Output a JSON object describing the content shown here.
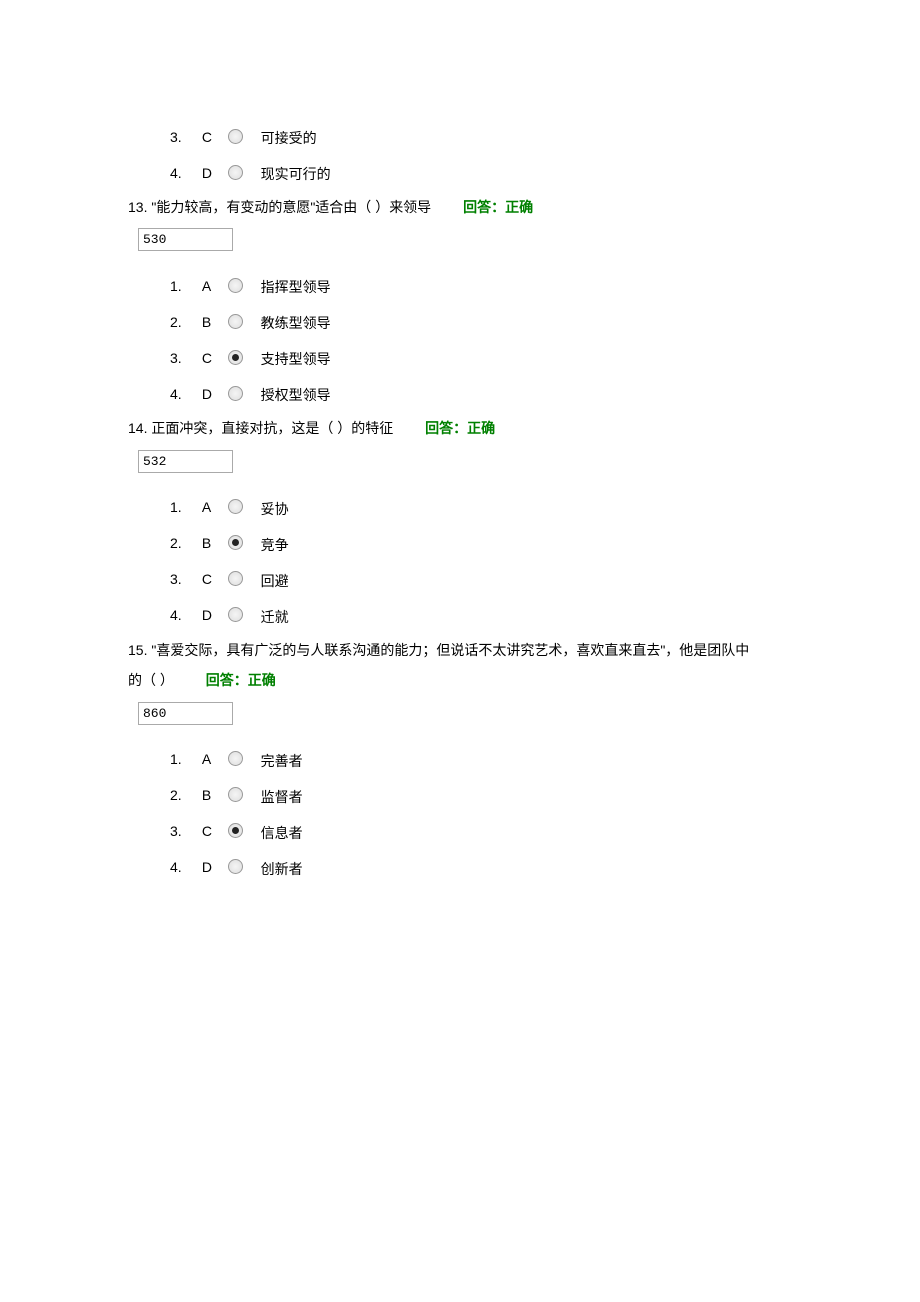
{
  "partial_q12": {
    "options": [
      {
        "num": "3.",
        "letter": "C",
        "text": "可接受的",
        "selected": false
      },
      {
        "num": "4.",
        "letter": "D",
        "text": "现实可行的",
        "selected": false
      }
    ]
  },
  "q13": {
    "number": "13.",
    "stem": "\"能力较高，有变动的意愿\"适合由（ ）来领导",
    "feedback_label": "回答：正确",
    "code": "530",
    "options": [
      {
        "num": "1.",
        "letter": "A",
        "text": "指挥型领导",
        "selected": false
      },
      {
        "num": "2.",
        "letter": "B",
        "text": "教练型领导",
        "selected": false
      },
      {
        "num": "3.",
        "letter": "C",
        "text": "支持型领导",
        "selected": true
      },
      {
        "num": "4.",
        "letter": "D",
        "text": "授权型领导",
        "selected": false
      }
    ]
  },
  "q14": {
    "number": "14.",
    "stem": "正面冲突，直接对抗，这是（ ）的特征",
    "feedback_label": "回答：正确",
    "code": "532",
    "options": [
      {
        "num": "1.",
        "letter": "A",
        "text": "妥协",
        "selected": false
      },
      {
        "num": "2.",
        "letter": "B",
        "text": "竞争",
        "selected": true
      },
      {
        "num": "3.",
        "letter": "C",
        "text": "回避",
        "selected": false
      },
      {
        "num": "4.",
        "letter": "D",
        "text": "迁就",
        "selected": false
      }
    ]
  },
  "q15": {
    "number": "15.",
    "stem_line1": "\"喜爱交际，具有广泛的与人联系沟通的能力；但说话不太讲究艺术，喜欢直来直去\"，他是团队中",
    "stem_line2": "的（ ）",
    "feedback_label": "回答：正确",
    "code": "860",
    "options": [
      {
        "num": "1.",
        "letter": "A",
        "text": "完善者",
        "selected": false
      },
      {
        "num": "2.",
        "letter": "B",
        "text": "监督者",
        "selected": false
      },
      {
        "num": "3.",
        "letter": "C",
        "text": "信息者",
        "selected": true
      },
      {
        "num": "4.",
        "letter": "D",
        "text": "创新者",
        "selected": false
      }
    ]
  }
}
